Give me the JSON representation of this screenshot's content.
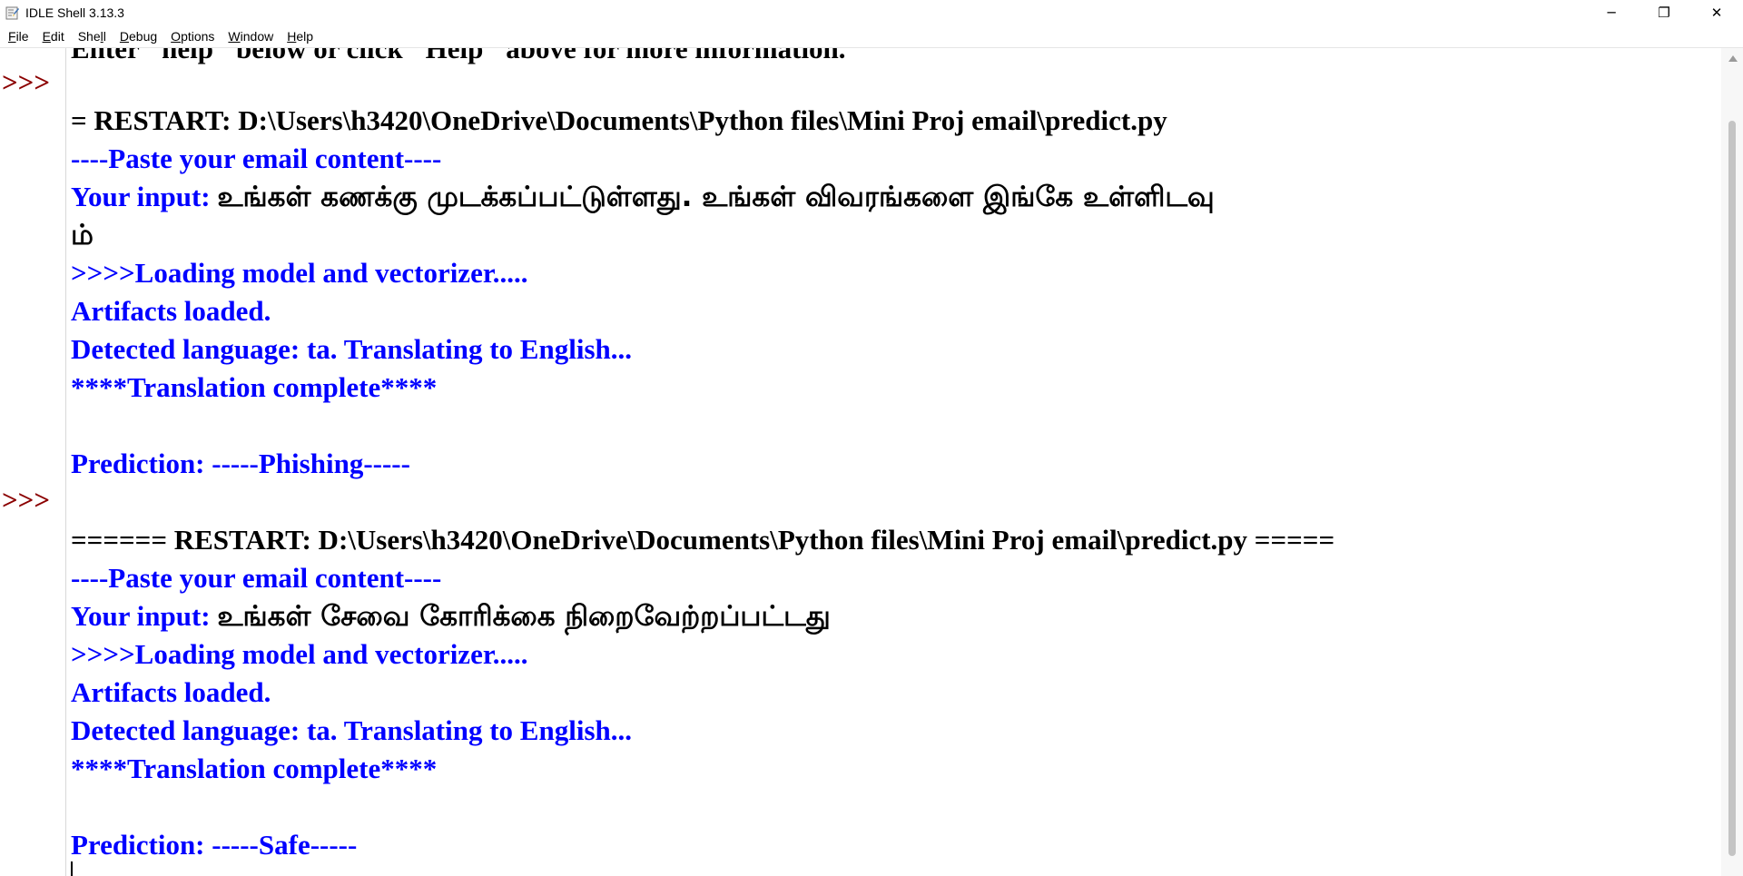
{
  "window": {
    "title": "IDLE Shell 3.13.3",
    "minimize": "─",
    "restore": "❐",
    "close": "✕"
  },
  "menu": [
    "File",
    "Edit",
    "Shell",
    "Debug",
    "Options",
    "Window",
    "Help"
  ],
  "menu_underline": [
    "F",
    "E",
    "S",
    "D",
    "O",
    "W",
    "H"
  ],
  "shell": {
    "prompt": ">>>",
    "lines": {
      "cut_top": "Enter \"help\" below or click \"Help\" above for more information.",
      "restart1": "= RESTART: D:\\Users\\h3420\\OneDrive\\Documents\\Python files\\Mini Proj email\\predict.py",
      "paste1": "----Paste your email content----",
      "input1_label": "Your input: ",
      "input1_text": "உங்கள் கணக்கு முடக்கப்பட்டுள்ளது. உங்கள் விவரங்களை இங்கே உள்ளிடவு",
      "input1_wrap": "ம்",
      "loading1": ">>>>Loading model and vectorizer.....",
      "artifacts1": "Artifacts loaded.",
      "detected1": "Detected language: ta. Translating to English...",
      "translation1": "****Translation complete****",
      "prediction1": "Prediction: -----Phishing-----",
      "restart2": "====== RESTART: D:\\Users\\h3420\\OneDrive\\Documents\\Python files\\Mini Proj email\\predict.py =====",
      "paste2": "----Paste your email content----",
      "input2_label": "Your input: ",
      "input2_text": "உங்கள் சேவை கோரிக்கை நிறைவேற்றப்பட்டது",
      "loading2": ">>>>Loading model and vectorizer.....",
      "artifacts2": "Artifacts loaded.",
      "detected2": "Detected language: ta. Translating to English...",
      "translation2": "****Translation complete****",
      "prediction2": "Prediction: -----Safe-----"
    }
  }
}
